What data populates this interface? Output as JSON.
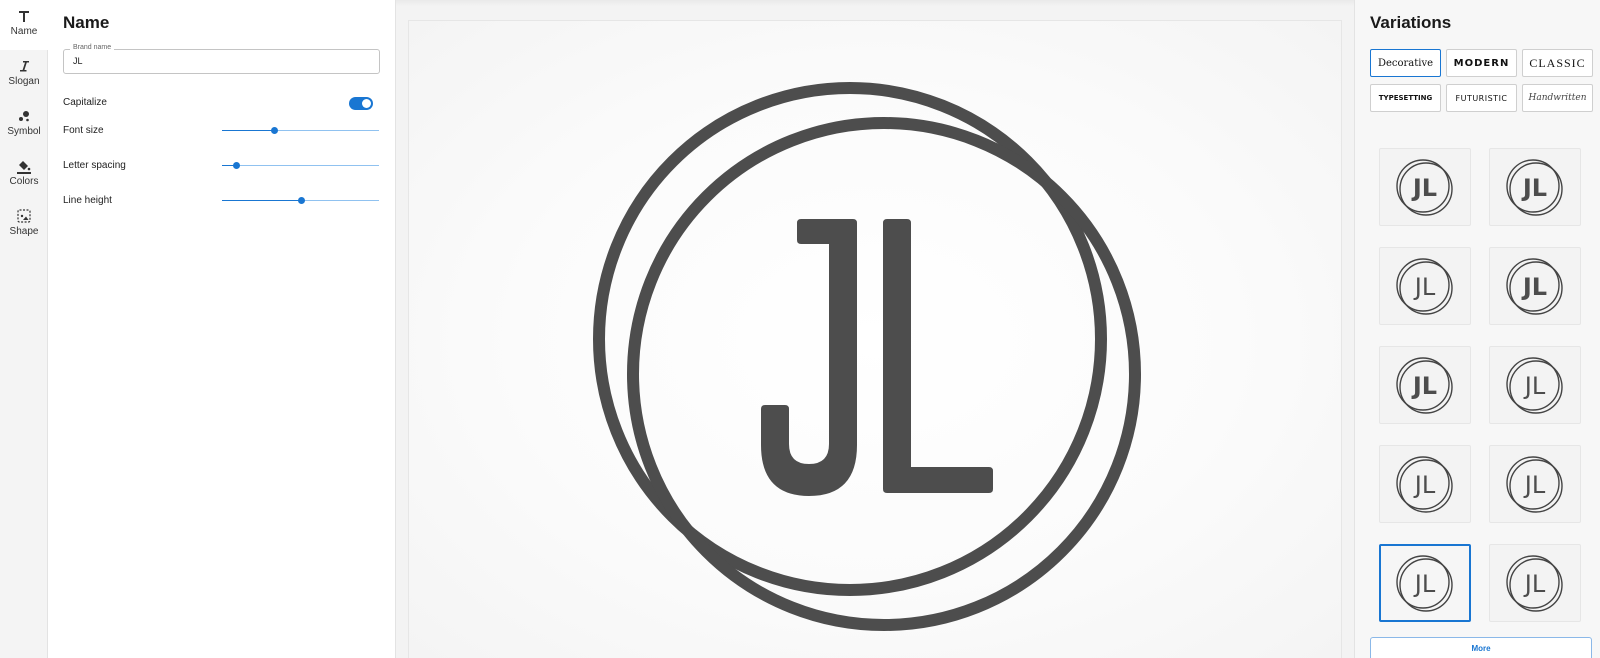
{
  "rail": {
    "items": [
      {
        "label": "Name",
        "icon": "text-t-icon"
      },
      {
        "label": "Slogan",
        "icon": "italic-i-icon"
      },
      {
        "label": "Symbol",
        "icon": "symbol-dots-icon"
      },
      {
        "label": "Colors",
        "icon": "paint-bucket-icon"
      },
      {
        "label": "Shape",
        "icon": "shape-frame-icon"
      }
    ]
  },
  "panel": {
    "title": "Name",
    "brand_field": {
      "legend": "Brand name",
      "value": "JL"
    },
    "capitalize": {
      "label": "Capitalize",
      "on": true
    },
    "sliders": [
      {
        "label": "Font size",
        "value": 0.33
      },
      {
        "label": "Letter spacing",
        "value": 0.09
      },
      {
        "label": "Line height",
        "value": 0.5
      }
    ]
  },
  "canvas": {
    "monogram": "JL",
    "logo_color": "#4d4d4d"
  },
  "variations": {
    "title": "Variations",
    "fonts": [
      {
        "label": "Decorative",
        "selected": true
      },
      {
        "label": "MODERN",
        "selected": false
      },
      {
        "label": "CLASSIC",
        "selected": false
      },
      {
        "label": "TYPESETTING",
        "selected": false
      },
      {
        "label": "FUTURISTIC",
        "selected": false
      },
      {
        "label": "Handwritten",
        "selected": false
      }
    ],
    "tiles": [
      {
        "text": "JL",
        "selected": false
      },
      {
        "text": "JL",
        "selected": false
      },
      {
        "text": "JL",
        "selected": false
      },
      {
        "text": "JL",
        "selected": false
      },
      {
        "text": "JL",
        "selected": false
      },
      {
        "text": "JL",
        "selected": false
      },
      {
        "text": "JL",
        "selected": false
      },
      {
        "text": "JL",
        "selected": false
      },
      {
        "text": "JL",
        "selected": true
      },
      {
        "text": "JL",
        "selected": false
      }
    ],
    "more_label": "More",
    "accent": "#1976d2"
  }
}
